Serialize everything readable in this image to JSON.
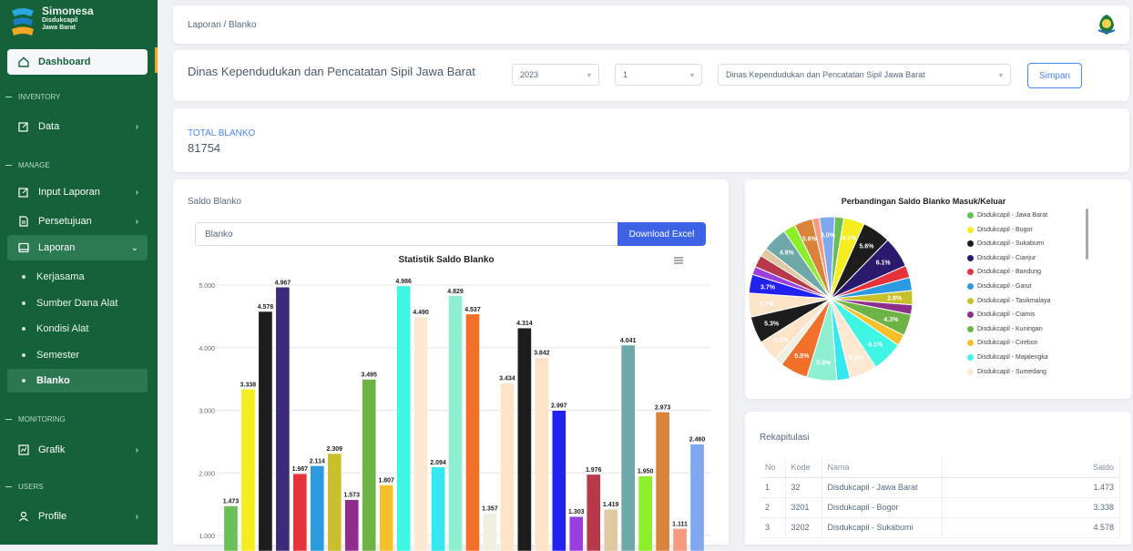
{
  "brand": {
    "title": "Simonesa",
    "line2": "Disdukcapil",
    "line3": "Jawa Barat"
  },
  "nav": {
    "dashboard": "Dashboard",
    "sec_inventory": "INVENTORY",
    "data": "Data",
    "sec_manage": "MANAGE",
    "input_laporan": "Input Laporan",
    "persetujuan": "Persetujuan",
    "laporan": "Laporan",
    "sub": [
      "Kerjasama",
      "Sumber Dana Alat",
      "Kondisi Alat",
      "Semester",
      "Blanko"
    ],
    "sec_monitoring": "MONITORING",
    "grafik": "Grafik",
    "sec_users": "USERS",
    "profile": "Profile"
  },
  "header": {
    "breadcrumb": "Laporan / Blanko"
  },
  "filter": {
    "title": "Dinas Kependudukan dan Pencatatan Sipil Jawa Barat",
    "year": "2023",
    "period": "1",
    "agency": "Dinas Kependudukan dan Pencatatan Sipil Jawa Barat",
    "save": "Simpan"
  },
  "total": {
    "label": "TOTAL BLANKO",
    "value": "81754"
  },
  "saldo": {
    "card_title": "Saldo Blanko",
    "input_value": "Blanko",
    "download": "Download Excel",
    "menu_icon": "hamburger-icon"
  },
  "colors": {
    "sidebar": "#15613a",
    "primary": "#3c63e6"
  },
  "chart_data": [
    {
      "type": "bar",
      "title": "Statistik Saldo Blanko",
      "ylim": [
        1000,
        5000
      ],
      "yticks": [
        "1.000",
        "2.000",
        "3.000",
        "4.000",
        "5.000"
      ],
      "values": [
        1473,
        3338,
        4578,
        4967,
        1987,
        2114,
        2309,
        1573,
        3495,
        1807,
        4986,
        4490,
        2094,
        4829,
        4537,
        1357,
        3434,
        4314,
        3842,
        2997,
        1303,
        1976,
        1419,
        4041,
        1950,
        2973,
        1111,
        2460
      ],
      "labels": [
        "1.473",
        "3.338",
        "4.578",
        "4.967",
        "1.987",
        "2.114",
        "2.309",
        "1.573",
        "3.495",
        "1.807",
        "4.986",
        "4.490",
        "2.094",
        "4.829",
        "4.537",
        "1.357",
        "3.434",
        "4.314",
        "3.842",
        "2.997",
        "1.303",
        "1.976",
        "1.419",
        "4.041",
        "1.950",
        "2.973",
        "1.111",
        "2.460"
      ],
      "colors": [
        "#6bbf59",
        "#f5ed1f",
        "#1d1d1d",
        "#3d2a7a",
        "#e6323b",
        "#2c9ae0",
        "#c8bf2a",
        "#8e2f8e",
        "#6db345",
        "#f7bf2a",
        "#3ff5e3",
        "#fde9d2",
        "#35e8f0",
        "#8ef0d0",
        "#f2702a",
        "#f0f0e0",
        "#fde3c8",
        "#1d1d1d",
        "#fde3c8",
        "#2121f0",
        "#9a3ee0",
        "#b83a4a",
        "#e0c8a0",
        "#6fa8a8",
        "#8bef2a",
        "#d9843a",
        "#f49a80",
        "#7fa8ef"
      ]
    },
    {
      "type": "pie",
      "title": "Perbandingan Saldo Blanko Masuk/Keluar",
      "legend": [
        "Disdukcapil - Jawa Barat",
        "Disdukcapil - Bogor",
        "Disdukcapil - Sukabumi",
        "Disdukcapil - Cianjur",
        "Disdukcapil - Bandung",
        "Disdukcapil - Garut",
        "Disdukcapil - Tasikmalaya",
        "Disdukcapil - Ciamis",
        "Disdukcapil - Kuningan",
        "Disdukcapil - Cirebon",
        "Disdukcapil - Majalengka",
        "Disdukcapil - Sumedang"
      ],
      "legend_colors": [
        "#6bbf59",
        "#f5ed1f",
        "#1d1d1d",
        "#2a1a6e",
        "#e6323b",
        "#2c9ae0",
        "#c8bf2a",
        "#8e2f8e",
        "#6db345",
        "#f7bf2a",
        "#3ff5e3",
        "#fde9d2"
      ],
      "slice_values": [
        1.8,
        4.1,
        5.6,
        6.1,
        2.4,
        2.6,
        2.8,
        1.9,
        4.3,
        2.2,
        6.1,
        5.5,
        2.6,
        5.9,
        5.5,
        1.7,
        4.2,
        5.3,
        4.7,
        3.7,
        1.6,
        2.4,
        1.7,
        4.9,
        2.4,
        3.6,
        1.4,
        3.0
      ],
      "slice_colors": [
        "#6bbf59",
        "#f5ed1f",
        "#1d1d1d",
        "#2a1a6e",
        "#e6323b",
        "#2c9ae0",
        "#c8bf2a",
        "#8e2f8e",
        "#6db345",
        "#f7bf2a",
        "#3ff5e3",
        "#fde9d2",
        "#35e8f0",
        "#8ef0d0",
        "#f2702a",
        "#f0f0e0",
        "#fde3c8",
        "#1d1d1d",
        "#fde3c8",
        "#2121f0",
        "#9a3ee0",
        "#b83a4a",
        "#e0c8a0",
        "#6fa8a8",
        "#8bef2a",
        "#d9843a",
        "#f49a80",
        "#7fa8ef"
      ],
      "slice_labels": [
        "",
        "4.1%",
        "5.6%",
        "6.1%",
        "",
        "",
        "2.8%",
        "",
        "4.3%",
        "",
        "6.1%",
        "5.5%",
        "",
        "5.9%",
        "5.5%",
        "",
        "4.2%",
        "5.3%",
        "4.7%",
        "3.7%",
        "",
        "",
        "",
        "4.9%",
        "",
        "3.6%",
        "",
        "3.0%"
      ]
    }
  ],
  "rekap": {
    "title": "Rekapitulasi",
    "headers": [
      "No",
      "Kode",
      "Nama",
      "Saldo"
    ],
    "rows": [
      [
        "1",
        "32",
        "Disdukcapil - Jawa Barat",
        "1.473"
      ],
      [
        "2",
        "3201",
        "Disdukcapil - Bogor",
        "3.338"
      ],
      [
        "3",
        "3202",
        "Disdukcapil - Sukabumi",
        "4.578"
      ]
    ]
  }
}
